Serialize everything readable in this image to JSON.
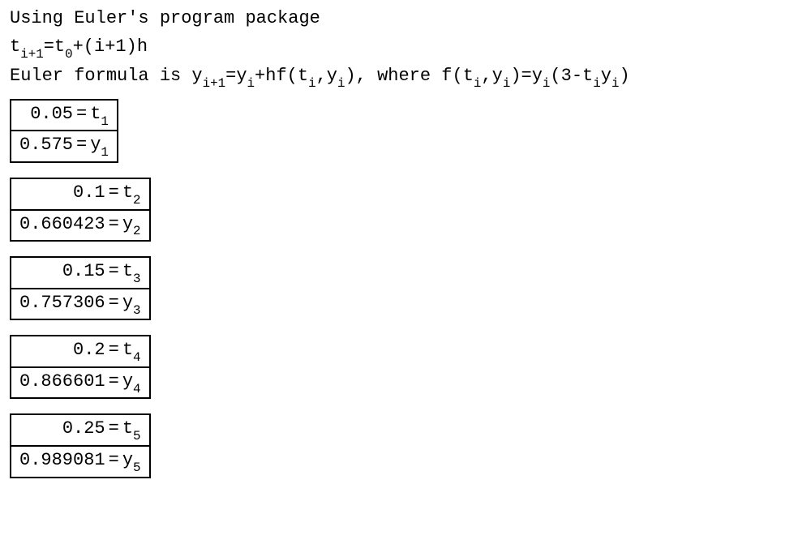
{
  "lines": {
    "line1": "Using Euler's program package",
    "line2": {
      "prefix": "t",
      "sub1": "i+1",
      "mid": "=t",
      "sub2": "0",
      "suffix": "+(i+1)h"
    },
    "line3": {
      "a": "Euler formula is y",
      "s1": "i+1",
      "b": "=y",
      "s2": "i",
      "c": "+hf(t",
      "s3": "i",
      "d": ",y",
      "s4": "i",
      "e": "), where f(t",
      "s5": "i",
      "f": ",y",
      "s6": "i",
      "g": ")=y",
      "s7": "i",
      "h": "(3-t",
      "s8": "i",
      "i": "y",
      "s9": "i",
      "j": ")"
    }
  },
  "results": [
    {
      "t_val": "0.05",
      "t_sub": "1",
      "y_val": "0.575",
      "y_sub": "1"
    },
    {
      "t_val": "0.1",
      "t_sub": "2",
      "y_val": "0.660423",
      "y_sub": "2"
    },
    {
      "t_val": "0.15",
      "t_sub": "3",
      "y_val": "0.757306",
      "y_sub": "3"
    },
    {
      "t_val": "0.2",
      "t_sub": "4",
      "y_val": "0.866601",
      "y_sub": "4"
    },
    {
      "t_val": "0.25",
      "t_sub": "5",
      "y_val": "0.989081",
      "y_sub": "5"
    }
  ],
  "symbols": {
    "eq": "=",
    "t": "t",
    "y": "y"
  }
}
